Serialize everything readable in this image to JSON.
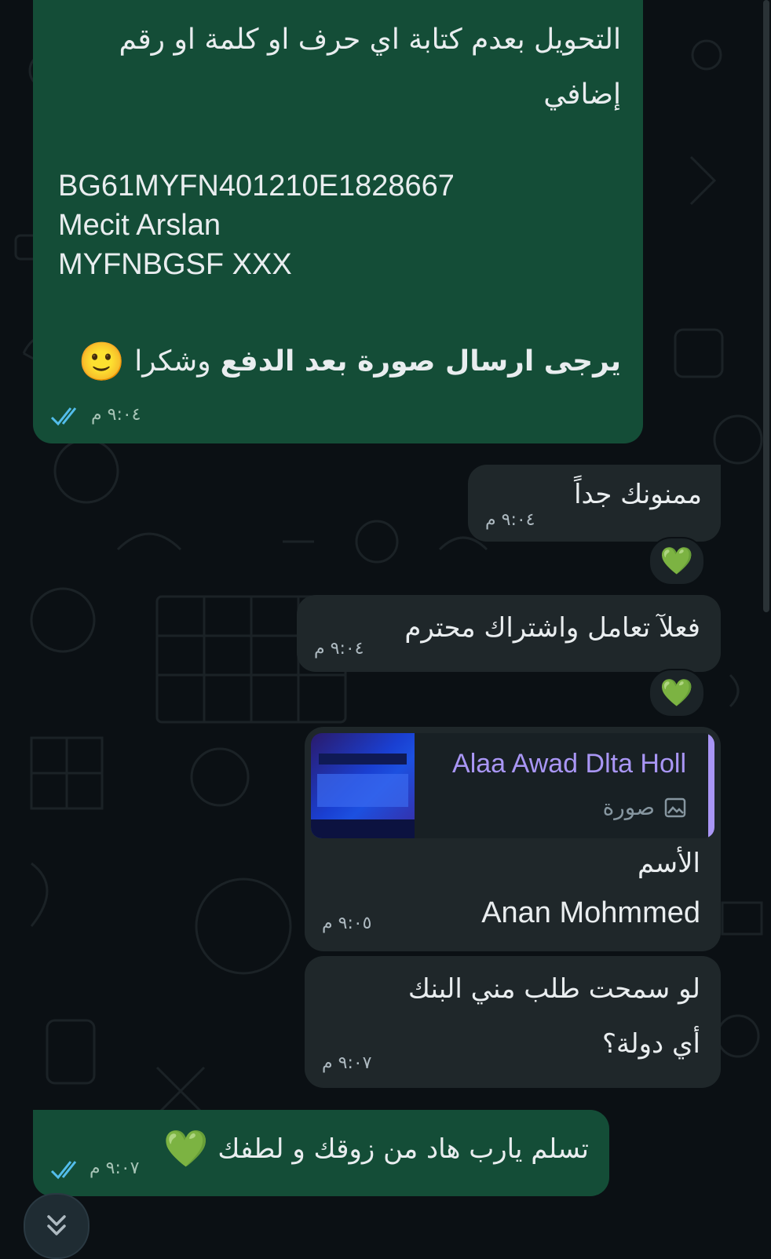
{
  "messages": [
    {
      "id": "m1",
      "direction": "outgoing",
      "lines": [
        "التحويل بعدم كتابة اي حرف او كلمة او رقم",
        "إضافي"
      ],
      "account_lines": [
        "BG61MYFN401210E1828667",
        "Mecit Arslan",
        "MYFNBGSF XXX"
      ],
      "bold_text": "يرجى ارسال صورة بعد الدفع",
      "rest_text": "وشكرا",
      "emoji": "🙂",
      "time": "٩:٠٤ م",
      "status": "read"
    },
    {
      "id": "m2",
      "direction": "incoming",
      "text": "ممنونك جداً",
      "time": "٩:٠٤ م",
      "reaction": "💚"
    },
    {
      "id": "m3",
      "direction": "incoming",
      "text": "فعلآ تعامل واشتراك محترم",
      "time": "٩:٠٤ م",
      "reaction": "💚"
    },
    {
      "id": "m4",
      "direction": "incoming",
      "quote": {
        "author": "Alaa Awad Dlta Holl",
        "type_label": "صورة",
        "accent": "#a996f5"
      },
      "lines": [
        "الأسم",
        "Anan Mohmmed"
      ],
      "time": "٩:٠٥ م"
    },
    {
      "id": "m5",
      "direction": "incoming",
      "lines": [
        "لو سمحت طلب مني البنك",
        "أي دولة؟"
      ],
      "time": "٩:٠٧ م"
    },
    {
      "id": "m6",
      "direction": "outgoing",
      "text": "تسلم يارب هاد من زوقك و لطفك",
      "emoji": "💚",
      "time": "٩:٠٧ م",
      "status": "read"
    }
  ],
  "colors": {
    "outgoing": "#144d37",
    "incoming": "#1f272a",
    "read_ticks": "#53bdeb",
    "background": "#0b1014"
  },
  "icons": {
    "scroll_down": "chevron-double-down-icon",
    "quote_type": "image-icon"
  }
}
